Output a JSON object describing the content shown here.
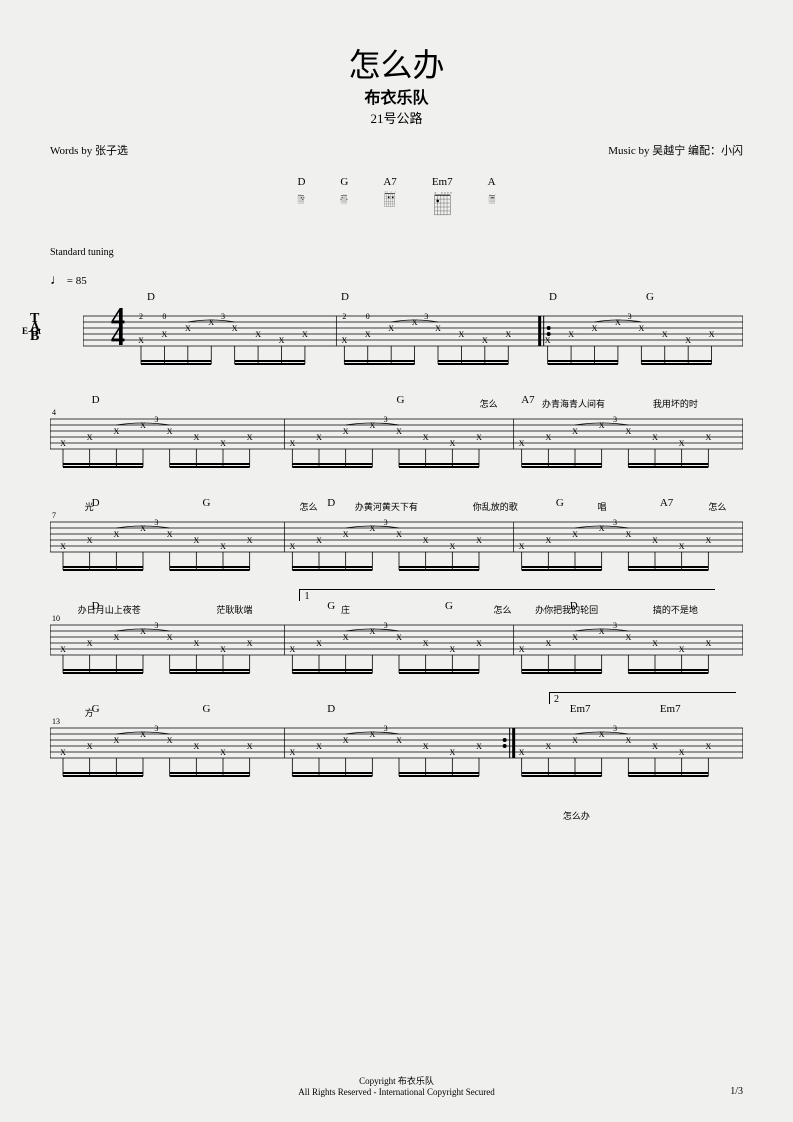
{
  "title": "怎么办",
  "artist": "布衣乐队",
  "album": "21号公路",
  "words_by": "Words by 张子选",
  "music_by": "Music by 吴越宁 编配：小闪",
  "chords": [
    {
      "name": "D"
    },
    {
      "name": "G"
    },
    {
      "name": "A7"
    },
    {
      "name": "Em7"
    },
    {
      "name": "A"
    }
  ],
  "tuning": "Standard tuning",
  "tempo_mark": "♩",
  "tempo": "= 85",
  "instrument": "E-Gt",
  "time_sig_top": "4",
  "time_sig_bot": "4",
  "systems": [
    {
      "chord_labels": [
        {
          "text": "D",
          "pos": 14
        },
        {
          "text": "D",
          "pos": 42
        },
        {
          "text": "D",
          "pos": 72
        },
        {
          "text": "G",
          "pos": 86
        }
      ],
      "lyrics": [
        {
          "text": "怎么",
          "pos": 62
        },
        {
          "text": "办青海青人间有",
          "pos": 71
        },
        {
          "text": "我用坏的时",
          "pos": 87
        }
      ],
      "bars": 3,
      "first": true
    },
    {
      "chord_labels": [
        {
          "text": "D",
          "pos": 6
        },
        {
          "text": "G",
          "pos": 50
        },
        {
          "text": "A7",
          "pos": 68
        }
      ],
      "lyrics": [
        {
          "text": "光",
          "pos": 5
        },
        {
          "text": "怎么",
          "pos": 36
        },
        {
          "text": "办黄河黄天下有",
          "pos": 44
        },
        {
          "text": "你乱放的歌",
          "pos": 61
        },
        {
          "text": "唱",
          "pos": 79
        },
        {
          "text": "怎么",
          "pos": 95
        }
      ],
      "bars": 3,
      "bar_num": 4
    },
    {
      "chord_labels": [
        {
          "text": "D",
          "pos": 6
        },
        {
          "text": "G",
          "pos": 22
        },
        {
          "text": "D",
          "pos": 40
        },
        {
          "text": "G",
          "pos": 73
        },
        {
          "text": "A7",
          "pos": 88
        }
      ],
      "lyrics": [
        {
          "text": "办日月山上夜苍",
          "pos": 4
        },
        {
          "text": "茫耿耿端",
          "pos": 24
        },
        {
          "text": "庄",
          "pos": 42
        },
        {
          "text": "怎么",
          "pos": 64
        },
        {
          "text": "办你把我的轮回",
          "pos": 70
        },
        {
          "text": "搞的不是地",
          "pos": 87
        }
      ],
      "bars": 3,
      "bar_num": 7
    },
    {
      "chord_labels": [
        {
          "text": "D",
          "pos": 6
        },
        {
          "text": "G",
          "pos": 40
        },
        {
          "text": "G",
          "pos": 57
        },
        {
          "text": "D",
          "pos": 75
        }
      ],
      "lyrics": [
        {
          "text": "方",
          "pos": 5
        }
      ],
      "bars": 3,
      "bar_num": 10,
      "ending1": 36
    },
    {
      "chord_labels": [
        {
          "text": "G",
          "pos": 6
        },
        {
          "text": "G",
          "pos": 22
        },
        {
          "text": "D",
          "pos": 40
        },
        {
          "text": "Em7",
          "pos": 75
        },
        {
          "text": "Em7",
          "pos": 88
        }
      ],
      "lyrics": [
        {
          "text": "怎么办",
          "pos": 74
        }
      ],
      "bars": 3,
      "bar_num": 13,
      "ending2": 72
    }
  ],
  "copyright1": "Copyright 布衣乐队",
  "copyright2": "All Rights Reserved - International Copyright Secured",
  "page": "1/3"
}
